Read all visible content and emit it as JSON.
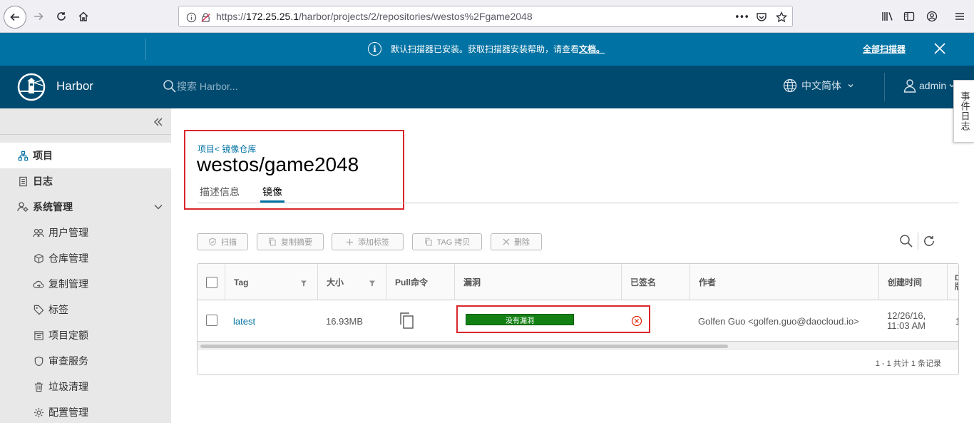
{
  "browser": {
    "url_prefix": "https://",
    "url_host": "172.25.25.1",
    "url_path": "/harbor/projects/2/repositories/westos%2Fgame2048",
    "more_label": "•••"
  },
  "banner": {
    "message": "默认扫描器已安装。获取扫描器安装帮助，请查看",
    "link": "文档。",
    "action": "全部扫描器"
  },
  "header": {
    "app_name": "Harbor",
    "search_placeholder": "搜索 Harbor...",
    "language": "中文简体",
    "user": "admin"
  },
  "event_tab": "事件日志",
  "sidebar": {
    "items": [
      {
        "label": "项目",
        "icon": "projects-icon"
      },
      {
        "label": "日志",
        "icon": "logs-icon"
      },
      {
        "label": "系统管理",
        "icon": "admin-icon"
      },
      {
        "label": "用户管理",
        "icon": "users-icon"
      },
      {
        "label": "仓库管理",
        "icon": "registry-icon"
      },
      {
        "label": "复制管理",
        "icon": "replication-icon"
      },
      {
        "label": "标签",
        "icon": "tag-icon"
      },
      {
        "label": "项目定额",
        "icon": "quota-icon"
      },
      {
        "label": "审查服务",
        "icon": "interrogation-icon"
      },
      {
        "label": "垃圾清理",
        "icon": "trash-icon"
      },
      {
        "label": "配置管理",
        "icon": "config-icon"
      }
    ]
  },
  "main": {
    "breadcrumb": "项目< 镜像仓库",
    "title": "westos/game2048",
    "tabs": [
      "描述信息",
      "镜像"
    ],
    "active_tab": "镜像",
    "toolbar": {
      "scan": "扫描",
      "copy_digest": "复制摘要",
      "add_label": "添加标签",
      "tag_copy": "TAG 拷贝",
      "delete": "删除"
    }
  },
  "table": {
    "columns": [
      "Tag",
      "大小",
      "Pull命令",
      "漏洞",
      "已签名",
      "作者",
      "创建时间",
      "D\n版"
    ],
    "rows": [
      {
        "tag": "latest",
        "size": "16.93MB",
        "vulnerability": "没有漏洞",
        "signed": false,
        "author": "Golfen Guo <golfen.guo@daocloud.io>",
        "created_line1": "12/26/16,",
        "created_line2": "11:03 AM",
        "extra": "1"
      }
    ],
    "footer": "1 - 1 共计 1 条记录"
  },
  "colors": {
    "banner": "#0072a3",
    "header": "#004a70",
    "sidebar": "#e8e8e8",
    "vuln_ok": "#138013",
    "highlight": "#d9262b"
  }
}
